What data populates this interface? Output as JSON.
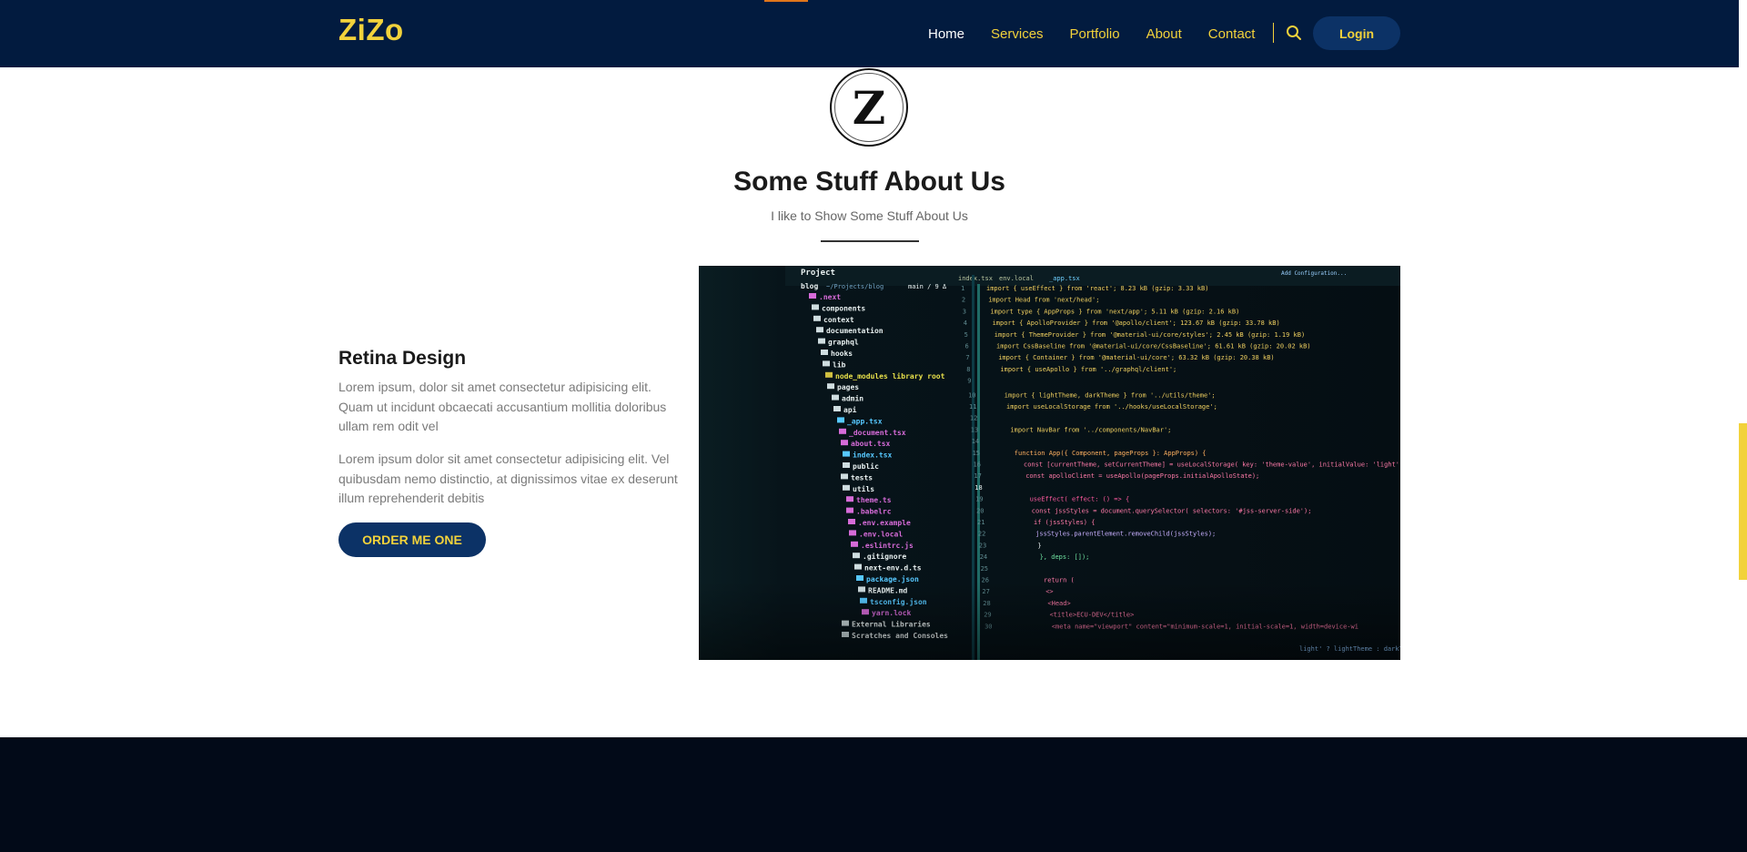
{
  "nav": {
    "brand": "ZiZo",
    "links": [
      "Home",
      "Services",
      "Portfolio",
      "About",
      "Contact"
    ],
    "login_label": "Login",
    "search_icon": "search-icon"
  },
  "about": {
    "logo_letter": "Z",
    "title": "Some Stuff About Us",
    "subtitle": "I like to Show Some Stuff About Us",
    "feature_title": "Retina Design",
    "paragraph_1": "Lorem ipsum, dolor sit amet consectetur adipisicing elit. Quam ut incidunt obcaecati accusantium mollitia doloribus ullam rem odit vel",
    "paragraph_2": "Lorem ipsum dolor sit amet consectetur adipisicing elit. Vel quibusdam nemo distinctio, at dignissimos vitae ex deserunt illum reprehenderit debitis",
    "button_label": "ORDER ME ONE",
    "image": {
      "project_label": "Project",
      "path": "~/Projects/blog",
      "branch": "main / 9 Δ",
      "tabs": [
        "index.tsx",
        "env.local",
        "_app.tsx"
      ],
      "top_right_label": "Add Configuration...",
      "tree": [
        ".next",
        "components",
        "context",
        "documentation",
        "graphql",
        "hooks",
        "lib",
        "node_modules  library root",
        "pages",
        "admin",
        "api",
        "_app.tsx",
        "_document.tsx",
        "about.tsx",
        "index.tsx",
        "public",
        "tests",
        "utils",
        "theme.ts",
        ".babelrc",
        ".env.example",
        ".env.local",
        ".eslintrc.js",
        ".gitignore",
        "next-env.d.ts",
        "package.json",
        "README.md",
        "tsconfig.json",
        "yarn.lock",
        "External Libraries",
        "Scratches and Consoles"
      ],
      "line_numbers": [
        "1",
        "2",
        "3",
        "4",
        "5",
        "6",
        "7",
        "8",
        "9",
        "10",
        "11",
        "12",
        "13",
        "14",
        "15",
        "16",
        "17",
        "18",
        "19",
        "20",
        "21",
        "22",
        "23",
        "24",
        "25",
        "26",
        "27",
        "28",
        "29",
        "30"
      ],
      "code": [
        "import { useEffect } from 'react';  8.23 kB (gzip: 3.33 kB)",
        "import Head from 'next/head';",
        "import type { AppProps } from 'next/app';  5.11 kB (gzip: 2.16 kB)",
        "import { ApolloProvider } from '@apollo/client';  123.67 kB (gzip: 33.78 kB)",
        "import { ThemeProvider } from '@material-ui/core/styles';  2.45 kB (gzip: 1.19 kB)",
        "import CssBaseline from '@material-ui/core/CssBaseline';  61.61 kB (gzip: 20.02 kB)",
        "import { Container } from '@material-ui/core';  63.32 kB (gzip: 20.38 kB)",
        "import { useApollo } from '../graphql/client';",
        "",
        "import { lightTheme, darkTheme } from '../utils/theme';",
        "import useLocalStorage from '../hooks/useLocalStorage';",
        "",
        "import NavBar from '../components/NavBar';",
        "",
        "function App({ Component, pageProps }: AppProps) {",
        "  const [currentTheme, setCurrentTheme] = useLocalStorage( key: 'theme-value', initialValue: 'light');",
        "  const apolloClient = useApollo(pageProps.initialApolloState);",
        "",
        "  useEffect( effect: () => {",
        "    const jssStyles = document.querySelector( selectors: '#jss-server-side');",
        "    if (jssStyles) {",
        "      jssStyles.parentElement.removeChild(jssStyles);",
        "    }",
        "  },  deps: []);",
        "",
        "  return (",
        "    <>",
        "      <Head>",
        "        <title>ECU-DEV</title>",
        "        <meta name=\"viewport\" content=\"minimum-scale=1, initial-scale=1, width=device-wi"
      ],
      "code_tail": "light' ? lightTheme : darkTheme}>"
    }
  },
  "colors": {
    "navbar_bg": "#021b3f",
    "accent_gold": "#f2d23b",
    "button_bg": "#0c3266",
    "footer_bg": "#020a18",
    "code_bg": "#06121a"
  }
}
